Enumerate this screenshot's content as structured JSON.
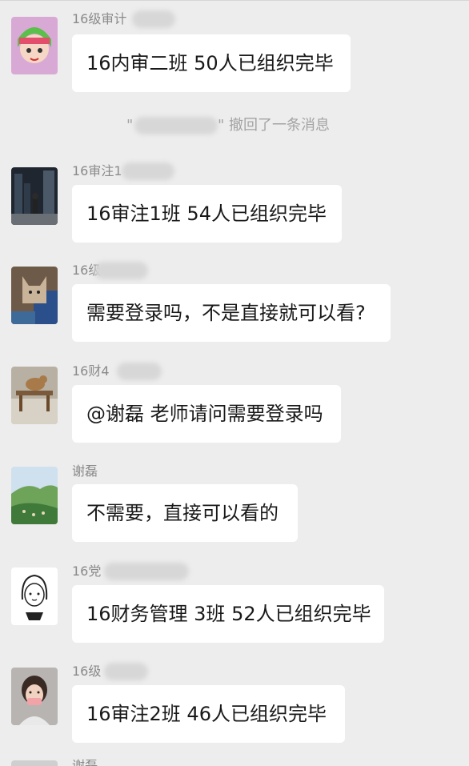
{
  "system_notice": {
    "left_quote": "\"",
    "text": "\" 撤回了一条消息"
  },
  "messages": [
    {
      "sender": "16级审计",
      "avatar": "cartoon-girl-avatar",
      "text": "16内审二班 50人已组织完毕"
    },
    {
      "sender": "16审注1",
      "avatar": "city-street-avatar",
      "text": "16审注1班 54人已组织完毕"
    },
    {
      "sender": "16级",
      "avatar": "cat-photo-avatar",
      "text": "需要登录吗，不是直接就可以看?"
    },
    {
      "sender": "16财4",
      "avatar": "dog-bench-avatar",
      "text": "@谢磊 老师请问需要登录吗"
    },
    {
      "sender": "谢磊",
      "avatar": "landscape-avatar",
      "text": "不需要，直接可以看的"
    },
    {
      "sender": "16党",
      "avatar": "sketch-girl-avatar",
      "text": "16财务管理 3班 52人已组织完毕"
    },
    {
      "sender": "16级",
      "avatar": "masked-girl-avatar",
      "text": "16审注2班 46人已组织完毕"
    }
  ],
  "partial_sender": "谢磊"
}
